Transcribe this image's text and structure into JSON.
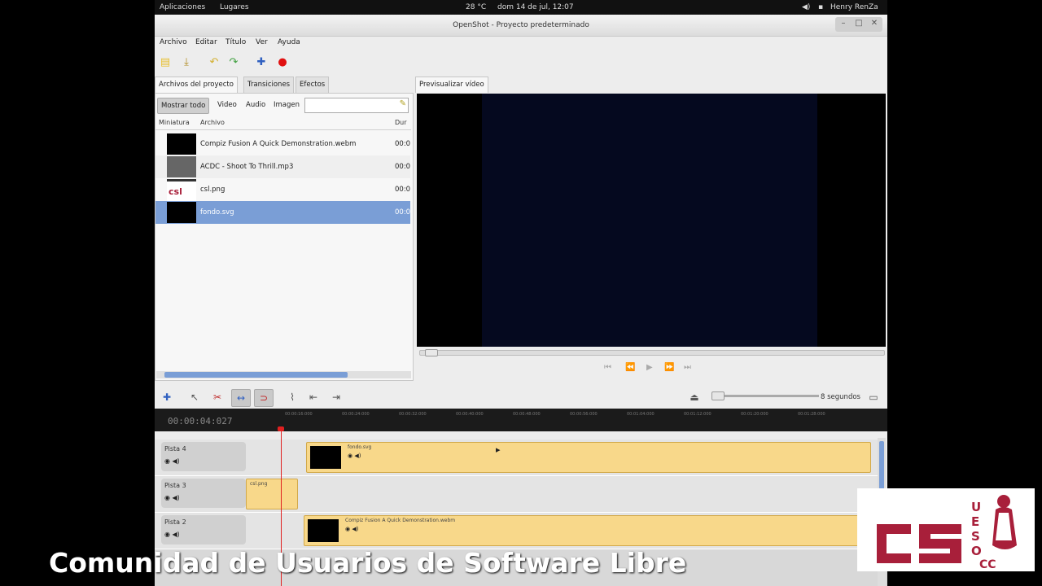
{
  "topbar": {
    "applications": "Aplicaciones",
    "places": "Lugares",
    "weather": "28 °C",
    "clock": "dom 14 de jul, 12:07",
    "user": "Henry RenZa"
  },
  "window": {
    "title": "OpenShot - Proyecto predeterminado"
  },
  "menu": [
    "Archivo",
    "Editar",
    "Título",
    "Ver",
    "Ayuda"
  ],
  "left_tabs": [
    "Archivos del proyecto",
    "Transiciones",
    "Efectos"
  ],
  "filters": {
    "all": "Mostrar todo",
    "video": "Video",
    "audio": "Audio",
    "image": "Imagen"
  },
  "file_columns": {
    "thumb": "Miniatura",
    "file": "Archivo",
    "duration": "Dur"
  },
  "files": [
    {
      "name": "Compiz Fusion A Quick Demonstration.webm",
      "dur": "00:0"
    },
    {
      "name": "ACDC - Shoot To Thrill.mp3",
      "dur": "00:0"
    },
    {
      "name": "csl.png",
      "dur": "00:0"
    },
    {
      "name": "fondo.svg",
      "dur": "00:0"
    }
  ],
  "preview_tab": "Previsualizar vídeo",
  "timeline": {
    "timecode": "00:00:04:027",
    "zoom_label": "8 segundos",
    "ticks": [
      "00:00:16:000",
      "00:00:24:000",
      "00:00:32:000",
      "00:00:40:000",
      "00:00:48:000",
      "00:00:56:000",
      "00:01:04:000",
      "00:01:12:000",
      "00:01:20:000",
      "00:01:28:000"
    ],
    "tracks": [
      {
        "name": "Pista 4",
        "clips": [
          {
            "name": "fondo.svg"
          }
        ]
      },
      {
        "name": "Pista 3",
        "clips": [
          {
            "name": "csl.png"
          }
        ]
      },
      {
        "name": "Pista 2",
        "clips": [
          {
            "name": "Compiz Fusion A Quick Demonstration.webm"
          }
        ]
      }
    ]
  },
  "overlay": {
    "banner": "Comunidad de Usuarios de Software Libre",
    "logo_text": "CS UESO OCC"
  },
  "colors": {
    "selection": "#7a9ed6",
    "clip": "#f8d88a",
    "playhead": "#e02020",
    "logo": "#a81f3a"
  }
}
